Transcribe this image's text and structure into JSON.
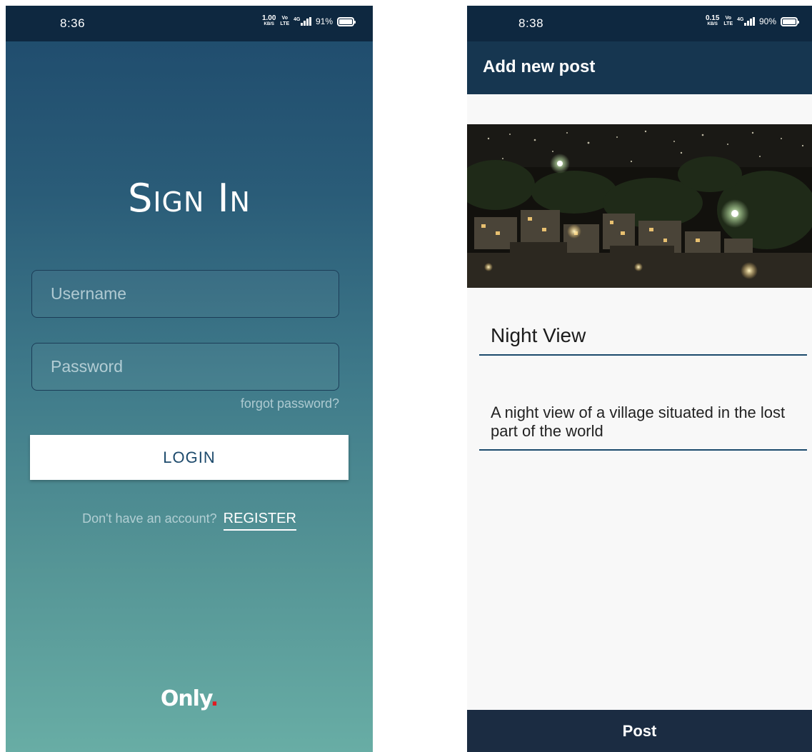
{
  "signin_screen": {
    "status_bar": {
      "time": "8:36",
      "net_speed": "1.00",
      "net_unit": "KB/S",
      "volte_top": "Vo",
      "volte_bottom": "LTE",
      "network": "4G",
      "battery": "91%"
    },
    "title": "Sign In",
    "username_placeholder": "Username",
    "password_placeholder": "Password",
    "forgot_password": "forgot password?",
    "login_button": "LOGIN",
    "no_account_text": "Don't have an account?",
    "register_link": "REGISTER",
    "logo_text": "Only",
    "logo_dot": ".",
    "logo_dot_color": "#e11b22"
  },
  "post_screen": {
    "status_bar": {
      "time": "8:38",
      "net_speed": "0.15",
      "net_unit": "KB/S",
      "volte_top": "Vo",
      "volte_bottom": "LTE",
      "network": "4G",
      "battery": "90%"
    },
    "app_bar_title": "Add new post",
    "image_description": "night-city-photo",
    "title_value": "Night View",
    "description_value": "A night view of a village situated in the lost part of the world",
    "post_button": "Post"
  },
  "colors": {
    "status_bar": "#0e2840",
    "app_bar": "#163650",
    "post_button": "#1b2c42",
    "gradient_top": "#1e4a6c",
    "gradient_bottom": "#68ada5",
    "login_text": "#1d4a6c"
  }
}
